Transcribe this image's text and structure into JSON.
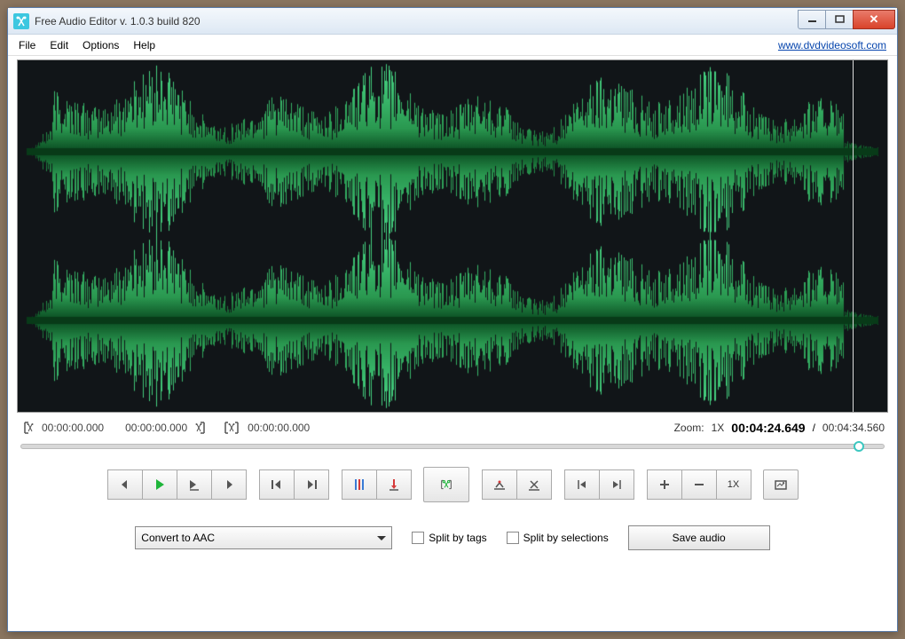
{
  "window": {
    "title": "Free Audio Editor v. 1.0.3 build 820"
  },
  "menubar": {
    "items": [
      "File",
      "Edit",
      "Options",
      "Help"
    ],
    "link": "www.dvdvideosoft.com"
  },
  "selection": {
    "start": "00:00:00.000",
    "end": "00:00:00.000",
    "cut_time": "00:00:00.000"
  },
  "status": {
    "zoom_label": "Zoom:",
    "zoom_value": "1X",
    "position": "00:04:24.649",
    "separator": "/",
    "duration": "00:04:34.560"
  },
  "zoom_btn_label": "1X",
  "convert": {
    "selected": "Convert to AAC"
  },
  "checkboxes": {
    "split_tags": "Split by tags",
    "split_selections": "Split by selections"
  },
  "buttons": {
    "save": "Save audio"
  },
  "colors": {
    "accent": "#3cc7e0",
    "play": "#1eb53a",
    "waveform_dark": "#0a4a20",
    "waveform_light": "#3bbf6e"
  }
}
